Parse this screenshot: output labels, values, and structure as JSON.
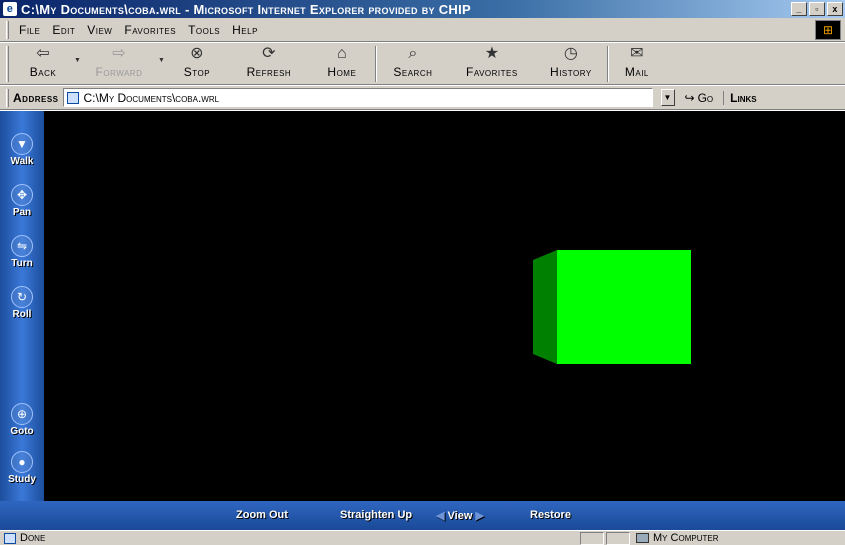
{
  "window": {
    "title": "C:\\My Documents\\coba.wrl - Microsoft Internet Explorer provided by CHIP",
    "controls": [
      "_",
      "▫",
      "x"
    ]
  },
  "menu": [
    "File",
    "Edit",
    "View",
    "Favorites",
    "Tools",
    "Help"
  ],
  "toolbar": {
    "back": "Back",
    "forward": "Forward",
    "stop": "Stop",
    "refresh": "Refresh",
    "home": "Home",
    "search": "Search",
    "favorites": "Favorites",
    "history": "History",
    "mail": "Mail"
  },
  "address": {
    "label": "Address",
    "value": "C:\\My Documents\\coba.wrl",
    "go": "Go",
    "links": "Links"
  },
  "vrml_nav": {
    "side": [
      "Walk",
      "Pan",
      "Turn",
      "Roll",
      "Goto",
      "Study"
    ],
    "bottom": {
      "zoom_out": "Zoom Out",
      "straighten_up": "Straighten Up",
      "view": "View",
      "restore": "Restore"
    }
  },
  "scene": {
    "background": "#000000",
    "cube_front": "#00ff00",
    "cube_side": "#008000"
  },
  "status": {
    "text": "Done",
    "zone": "My Computer"
  }
}
